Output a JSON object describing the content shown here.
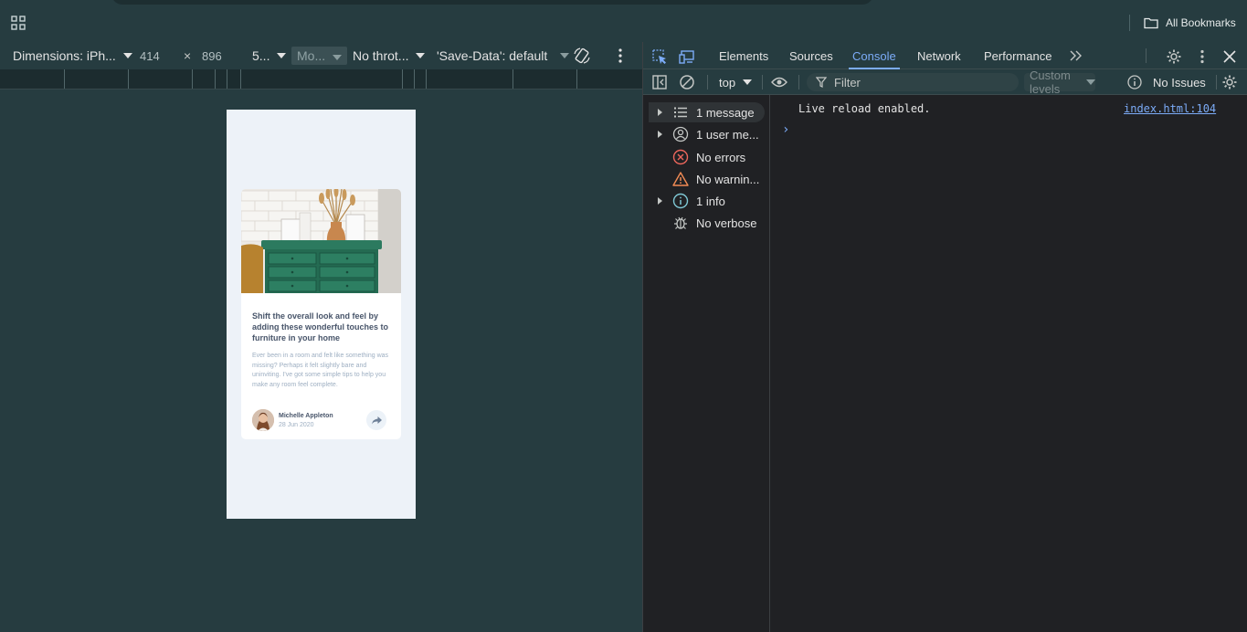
{
  "browser": {
    "bookmarks_label": "All Bookmarks",
    "icons": [
      "apps-grid-icon",
      "folder-icon"
    ]
  },
  "device_toolbar": {
    "dimensions_label": "Dimensions: iPh...",
    "width": "414",
    "times": "×",
    "height": "896",
    "zoom": "5...",
    "mode": "Mo...",
    "throttle": "No throt...",
    "save_data": "'Save-Data': default"
  },
  "card": {
    "title": "Shift the overall look and feel by adding these wonderful touches to furniture in your home",
    "description": "Ever been in a room and felt like something was missing? Perhaps it felt slightly bare and uninviting. I've got some simple tips to help you make any room feel complete.",
    "author": "Michelle Appleton",
    "date": "28 Jun 2020"
  },
  "devtools": {
    "tabs": [
      "Elements",
      "Sources",
      "Console",
      "Network",
      "Performance"
    ],
    "active_tab": "Console",
    "colors": {
      "accent": "#7cacf8",
      "error": "#ee675c",
      "warning": "#f28b54",
      "info": "#7fc8d5"
    }
  },
  "console_toolbar": {
    "context": "top",
    "filter_placeholder": "Filter",
    "levels": "Custom levels",
    "issues": "No Issues"
  },
  "sidebar": {
    "items": [
      {
        "label": "1 message",
        "icon": "list-icon"
      },
      {
        "label": "1 user me...",
        "icon": "user-icon"
      },
      {
        "label": "No errors",
        "icon": "error-icon"
      },
      {
        "label": "No warnin...",
        "icon": "warning-icon"
      },
      {
        "label": "1 info",
        "icon": "info-icon"
      },
      {
        "label": "No verbose",
        "icon": "bug-icon"
      }
    ]
  },
  "console": {
    "log_text": "Live reload enabled.",
    "log_source": "index.html:104",
    "prompt": "›"
  }
}
